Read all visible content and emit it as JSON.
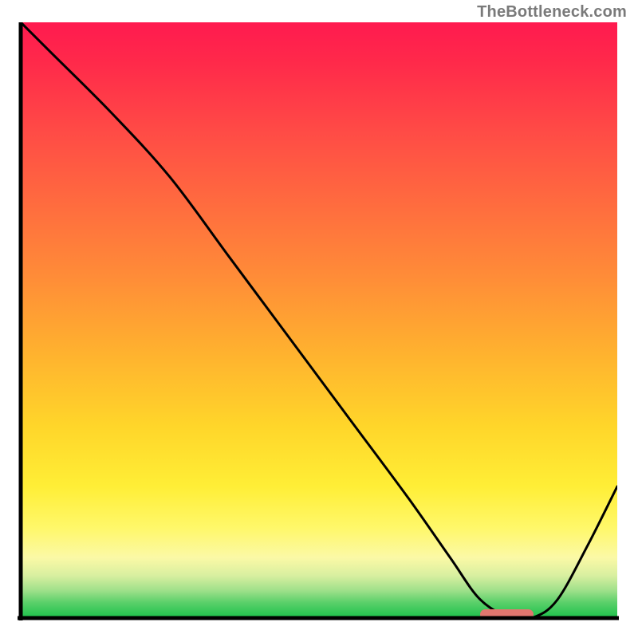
{
  "attribution": "TheBottleneck.com",
  "colors": {
    "gradient_top": "#ff1a4f",
    "gradient_mid": "#ffd62a",
    "gradient_bottom": "#1fc24d",
    "curve": "#000000",
    "marker": "#e1776f",
    "axis": "#000000",
    "attribution_text": "#7a7a7a"
  },
  "chart_data": {
    "type": "line",
    "title": "",
    "xlabel": "",
    "ylabel": "",
    "xlim": [
      0,
      100
    ],
    "ylim": [
      0,
      100
    ],
    "grid": false,
    "legend": null,
    "series": [
      {
        "name": "bottleneck-curve",
        "x": [
          0,
          5,
          15,
          25,
          35,
          45,
          55,
          65,
          72,
          77,
          82,
          86,
          90,
          95,
          100
        ],
        "values": [
          100,
          95,
          85,
          74,
          60.5,
          47,
          33.5,
          20,
          10,
          3,
          0,
          0,
          3,
          12,
          22
        ]
      }
    ],
    "annotations": [
      {
        "name": "target-marker",
        "x_range": [
          77,
          86
        ],
        "y": 0.5
      }
    ]
  }
}
